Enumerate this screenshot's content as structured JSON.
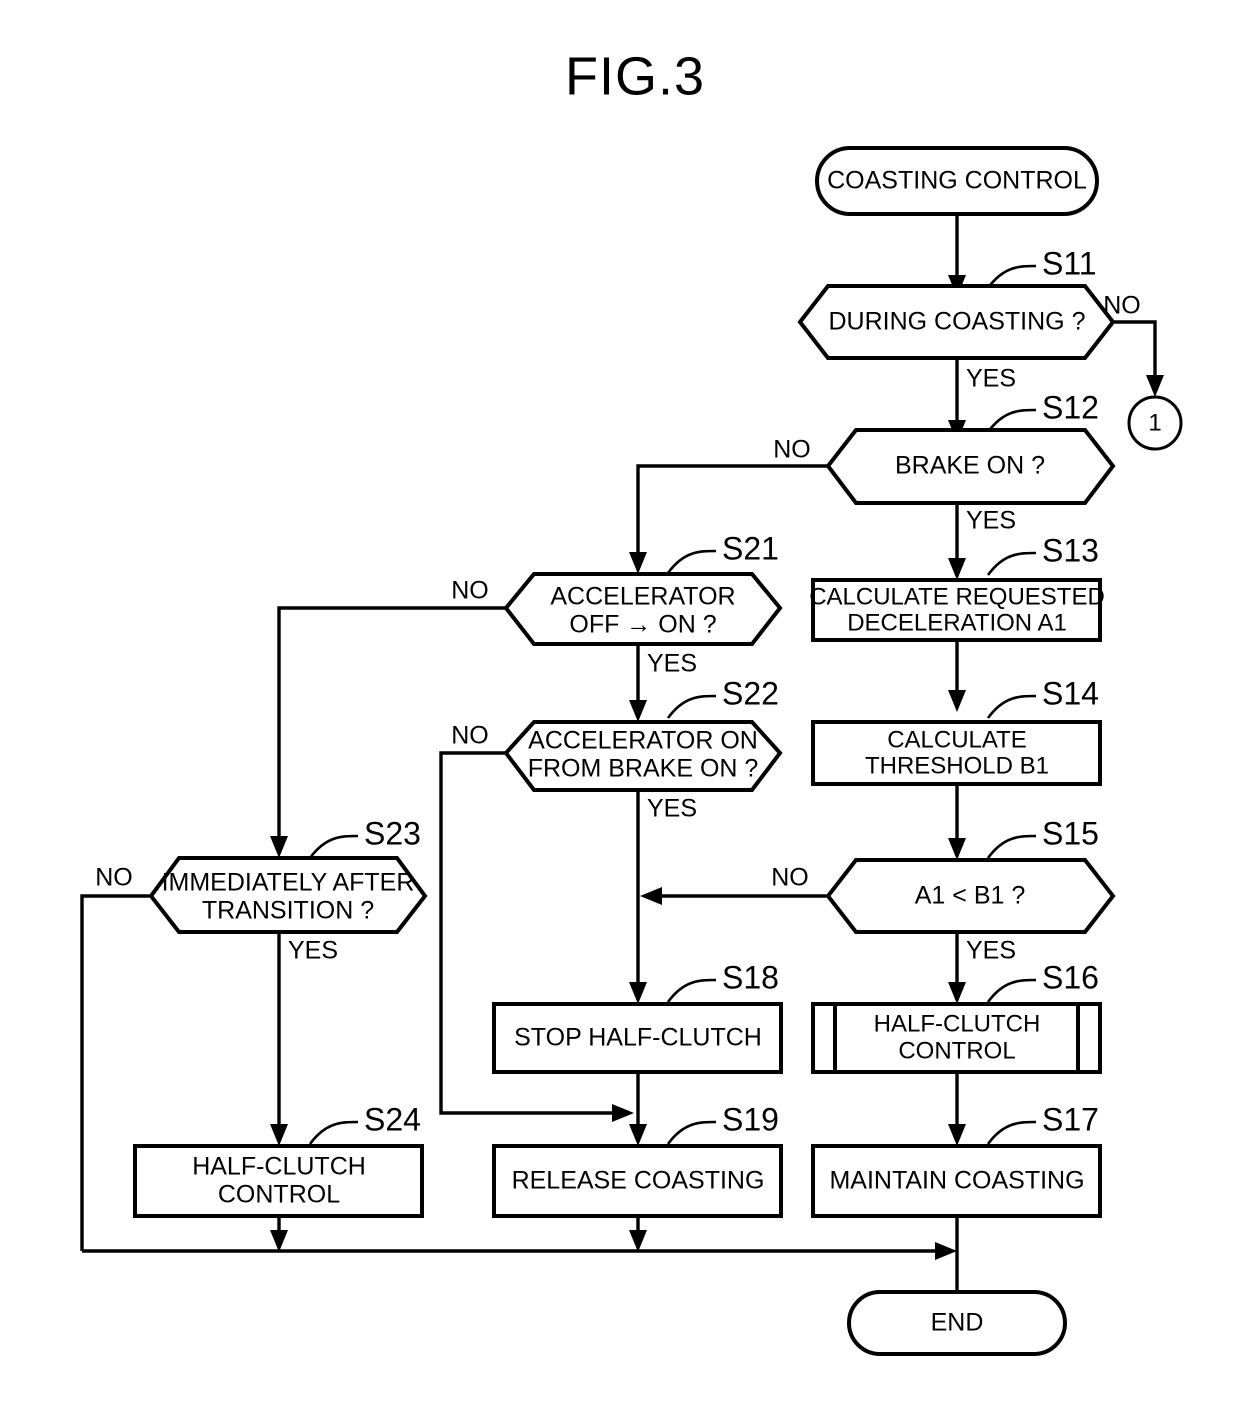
{
  "figure": {
    "title": "FIG.3",
    "type": "flowchart",
    "domain": "Diagram"
  },
  "nodes": {
    "start": {
      "id": "start",
      "shape": "terminator",
      "label": "COASTING CONTROL",
      "step": ""
    },
    "s11": {
      "id": "S11",
      "shape": "decision",
      "label": "DURING COASTING ?",
      "step": "S11"
    },
    "s12": {
      "id": "S12",
      "shape": "decision",
      "label": "BRAKE ON ?",
      "step": "S12"
    },
    "s13": {
      "id": "S13",
      "shape": "process",
      "label_line1": "CALCULATE REQUESTED",
      "label_line2": "DECELERATION A1",
      "step": "S13"
    },
    "s14": {
      "id": "S14",
      "shape": "process",
      "label_line1": "CALCULATE",
      "label_line2": "THRESHOLD B1",
      "step": "S14"
    },
    "s15": {
      "id": "S15",
      "shape": "decision",
      "label": "A1 < B1 ?",
      "step": "S15"
    },
    "s16": {
      "id": "S16",
      "shape": "predefined-process",
      "label_line1": "HALF-CLUTCH",
      "label_line2": "CONTROL",
      "step": "S16"
    },
    "s17": {
      "id": "S17",
      "shape": "process",
      "label": "MAINTAIN COASTING",
      "step": "S17"
    },
    "s18": {
      "id": "S18",
      "shape": "process",
      "label": "STOP HALF-CLUTCH",
      "step": "S18"
    },
    "s19": {
      "id": "S19",
      "shape": "process",
      "label": "RELEASE COASTING",
      "step": "S19"
    },
    "s21": {
      "id": "S21",
      "shape": "decision",
      "label_line1": "ACCELERATOR",
      "label_line2": "OFF → ON ?",
      "step": "S21"
    },
    "s22": {
      "id": "S22",
      "shape": "decision",
      "label_line1": "ACCELERATOR ON",
      "label_line2": "FROM BRAKE ON ?",
      "step": "S22"
    },
    "s23": {
      "id": "S23",
      "shape": "decision",
      "label_line1": "IMMEDIATELY AFTER",
      "label_line2": "TRANSITION ?",
      "step": "S23"
    },
    "s24": {
      "id": "S24",
      "shape": "process",
      "label_line1": "HALF-CLUTCH",
      "label_line2": "CONTROL",
      "step": "S24"
    },
    "connector1": {
      "id": "connector-1",
      "shape": "off-page-connector",
      "label": "1"
    },
    "end": {
      "id": "end",
      "shape": "terminator",
      "label": "END",
      "step": ""
    }
  },
  "branch_labels": {
    "s11_no": "NO",
    "s11_yes": "YES",
    "s12_no": "NO",
    "s12_yes": "YES",
    "s15_no": "NO",
    "s15_yes": "YES",
    "s21_no": "NO",
    "s21_yes": "YES",
    "s22_no": "NO",
    "s22_yes": "YES",
    "s23_no": "NO",
    "s23_yes": "YES"
  },
  "colors": {
    "stroke": "#000000",
    "fill": "#ffffff",
    "background": "#ffffff"
  }
}
